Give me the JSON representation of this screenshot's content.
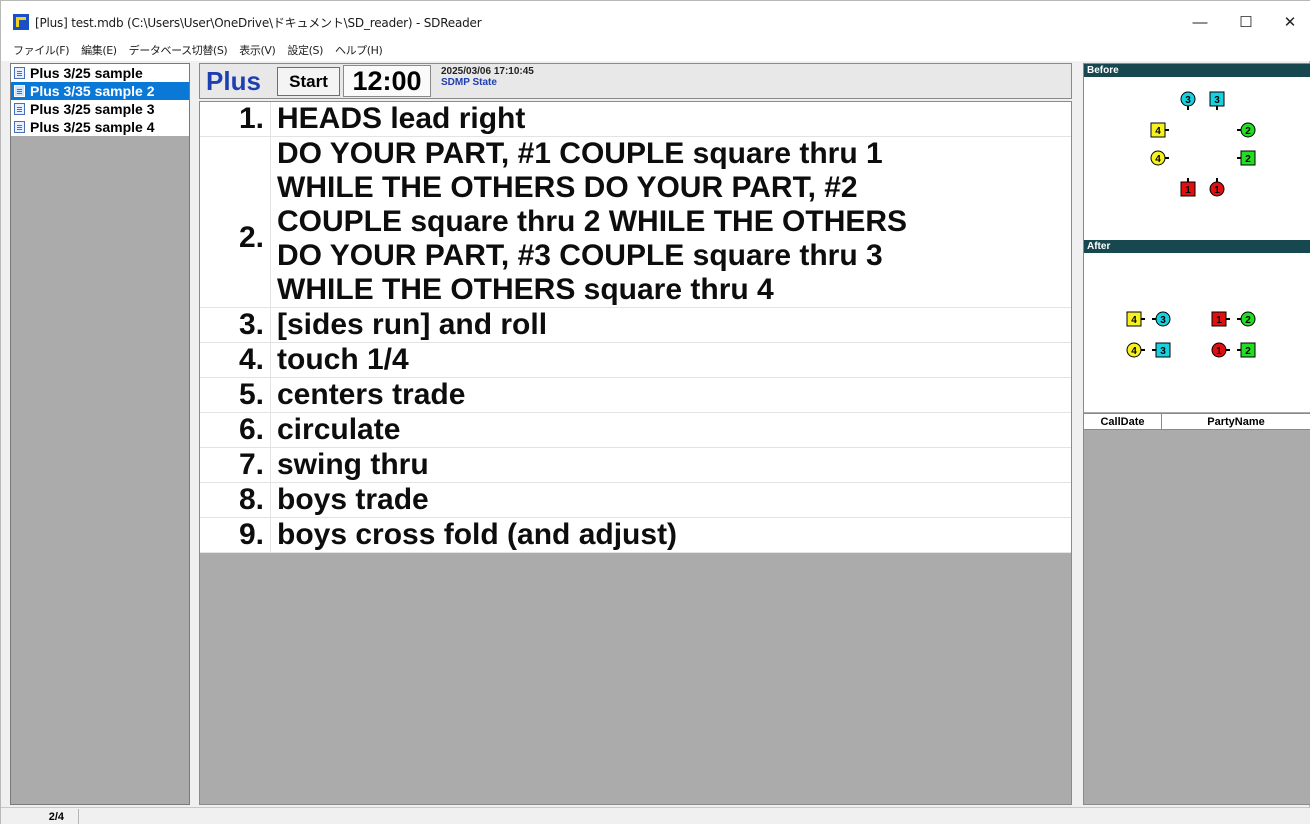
{
  "window": {
    "title": "[Plus] test.mdb (C:\\Users\\User\\OneDrive\\ドキュメント\\SD_reader) - SDReader",
    "controls": {
      "minimize": "—",
      "maximize": "☐",
      "close": "✕"
    }
  },
  "menu": [
    "ファイル(F)",
    "編集(E)",
    "データベース切替(S)",
    "表示(V)",
    "設定(S)",
    "ヘルプ(H)"
  ],
  "sessions": [
    {
      "label": "Plus 3/25 sample",
      "selected": false
    },
    {
      "label": "Plus 3/35 sample 2",
      "selected": true
    },
    {
      "label": "Plus 3/25 sample 3",
      "selected": false
    },
    {
      "label": "Plus 3/25 sample 4",
      "selected": false
    }
  ],
  "header": {
    "level": "Plus",
    "start_label": "Start",
    "timer": "12:00",
    "datetime": "2025/03/06 17:10:45",
    "state": "SDMP State"
  },
  "calls": [
    {
      "num": "1.",
      "text": "HEADS lead right"
    },
    {
      "num": "2.",
      "text": "DO YOUR PART, #1 COUPLE square thru 1\nWHILE THE OTHERS DO YOUR PART, #2\nCOUPLE square thru 2 WHILE THE OTHERS\nDO YOUR PART, #3 COUPLE square thru 3\nWHILE THE OTHERS square thru 4"
    },
    {
      "num": "3.",
      "text": "[sides run] and roll"
    },
    {
      "num": "4.",
      "text": "touch 1/4"
    },
    {
      "num": "5.",
      "text": "centers trade"
    },
    {
      "num": "6.",
      "text": "circulate"
    },
    {
      "num": "7.",
      "text": "swing thru"
    },
    {
      "num": "8.",
      "text": "boys trade"
    },
    {
      "num": "9.",
      "text": "boys cross fold (and adjust)"
    }
  ],
  "diagrams": {
    "before": {
      "label": "Before",
      "dancers": [
        {
          "shape": "circle",
          "num": "3",
          "color": "#19d0e0",
          "facing": "down"
        },
        {
          "shape": "square",
          "num": "3",
          "color": "#19d0e0",
          "facing": "down"
        },
        {
          "shape": "square",
          "num": "4",
          "color": "#f5f020",
          "facing": "right"
        },
        {
          "shape": "circle",
          "num": "2",
          "color": "#22dd22",
          "facing": "left"
        },
        {
          "shape": "circle",
          "num": "4",
          "color": "#f5f020",
          "facing": "right"
        },
        {
          "shape": "square",
          "num": "2",
          "color": "#22dd22",
          "facing": "left"
        },
        {
          "shape": "square",
          "num": "1",
          "color": "#e01010",
          "facing": "up"
        },
        {
          "shape": "circle",
          "num": "1",
          "color": "#e01010",
          "facing": "up"
        }
      ]
    },
    "after": {
      "label": "After",
      "dancers": [
        {
          "shape": "square",
          "num": "4",
          "color": "#f5f020",
          "facing": "right"
        },
        {
          "shape": "circle",
          "num": "3",
          "color": "#19d0e0",
          "facing": "left"
        },
        {
          "shape": "square",
          "num": "1",
          "color": "#e01010",
          "facing": "right"
        },
        {
          "shape": "circle",
          "num": "2",
          "color": "#22dd22",
          "facing": "left"
        },
        {
          "shape": "circle",
          "num": "4",
          "color": "#f5f020",
          "facing": "right"
        },
        {
          "shape": "square",
          "num": "3",
          "color": "#19d0e0",
          "facing": "left"
        },
        {
          "shape": "circle",
          "num": "1",
          "color": "#e01010",
          "facing": "right"
        },
        {
          "shape": "square",
          "num": "2",
          "color": "#22dd22",
          "facing": "left"
        }
      ]
    }
  },
  "history": {
    "col_date": "CallDate",
    "col_party": "PartyName"
  },
  "status": {
    "page": "2/4"
  },
  "colors": {
    "accent": "#0a78d7",
    "level_blue": "#1e3fb0",
    "diagram_header": "#17484f"
  }
}
